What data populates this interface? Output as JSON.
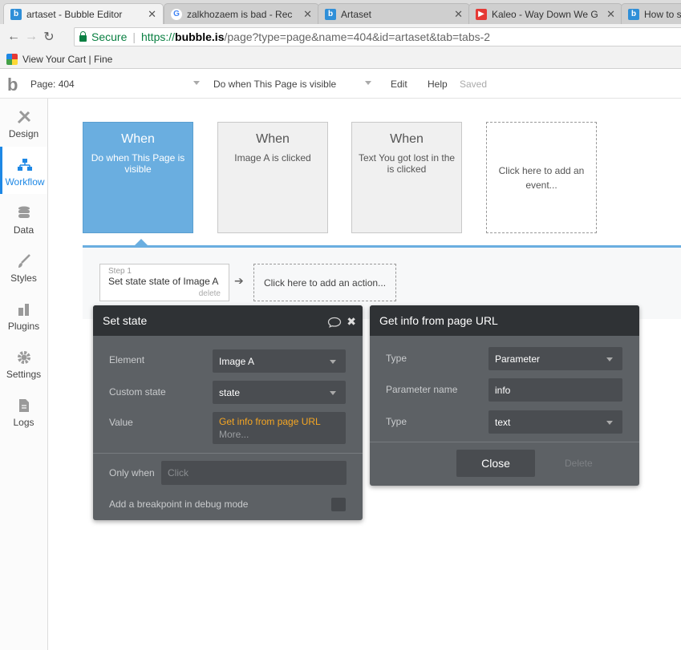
{
  "browser": {
    "tabs": [
      {
        "title": "artaset - Bubble Editor",
        "favicon": "bubble-icon",
        "active": true
      },
      {
        "title": "zalkhozaem is bad - Rec",
        "favicon": "google-icon"
      },
      {
        "title": "Artaset",
        "favicon": "bubble-icon"
      },
      {
        "title": "Kaleo - Way Down We G",
        "favicon": "youtube-icon"
      },
      {
        "title": "How to s",
        "favicon": "bubble-icon"
      }
    ],
    "secure_label": "Secure",
    "url_scheme": "https://",
    "url_host": "bubble.is",
    "url_path": "/page?type=page&name=404&id=artaset&tab=tabs-2",
    "bookmark_label": "View Your Cart | Fine"
  },
  "appbar": {
    "page_label": "Page: 404",
    "workflow_select": "Do when This Page is visible",
    "edit": "Edit",
    "help": "Help",
    "saved": "Saved"
  },
  "sidebar": {
    "items": [
      {
        "label": "Design",
        "icon": "design-icon"
      },
      {
        "label": "Workflow",
        "icon": "workflow-icon",
        "active": true
      },
      {
        "label": "Data",
        "icon": "data-icon"
      },
      {
        "label": "Styles",
        "icon": "styles-icon"
      },
      {
        "label": "Plugins",
        "icon": "plugins-icon"
      },
      {
        "label": "Settings",
        "icon": "settings-icon"
      },
      {
        "label": "Logs",
        "icon": "logs-icon"
      }
    ]
  },
  "events": [
    {
      "when": "When",
      "desc": "Do when This Page is visible",
      "active": true
    },
    {
      "when": "When",
      "desc": "Image A is clicked"
    },
    {
      "when": "When",
      "desc": "Text You got lost in the is clicked"
    },
    {
      "add": "Click here to add an event..."
    }
  ],
  "step": {
    "number": "Step 1",
    "title": "Set state state of Image A",
    "delete": "delete",
    "add_action": "Click here to add an action..."
  },
  "set_state_panel": {
    "title": "Set state",
    "element_label": "Element",
    "element_value": "Image A",
    "custom_state_label": "Custom state",
    "custom_state_value": "state",
    "value_label": "Value",
    "value_expression": "Get info from page URL",
    "value_more": "More...",
    "only_when_label": "Only when",
    "only_when_placeholder": "Click",
    "breakpoint_label": "Add a breakpoint in debug mode",
    "accent_color": "#f5a623"
  },
  "url_panel": {
    "title": "Get info from page URL",
    "type_label": "Type",
    "type_value": "Parameter",
    "param_name_label": "Parameter name",
    "param_name_value": "info",
    "type2_label": "Type",
    "type2_value": "text",
    "close": "Close",
    "delete": "Delete"
  }
}
